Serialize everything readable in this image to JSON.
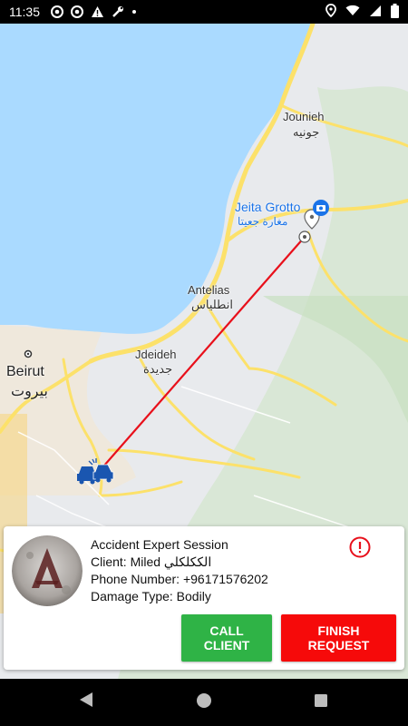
{
  "status_bar": {
    "time": "11:35",
    "left_icons": [
      "chrome-icon",
      "chrome-icon",
      "warning-icon",
      "wrench-icon",
      "dot-icon"
    ],
    "right_icons": [
      "location-icon",
      "wifi-icon",
      "signal-icon",
      "battery-icon"
    ]
  },
  "map": {
    "labels": {
      "jounieh": "Jounieh",
      "jounieh_ar": "جونيه",
      "jeita": "Jeita Grotto",
      "jeita_ar": "مغارة جعيتا",
      "antelias": "Antelias",
      "antelias_ar": "انطلياس",
      "jdeideh": "Jdeideh",
      "jdeideh_ar": "جديدة",
      "beirut": "Beirut",
      "beirut_ar": "بيروت"
    },
    "colors": {
      "water": "#aadaff",
      "land": "#e8eaed",
      "route": "#e8101b",
      "road": "#fce16a"
    }
  },
  "session": {
    "title": "Accident Expert Session",
    "client": "Client: Miled الككلكلي",
    "phone": "Phone Number: +96171576202",
    "damage": "Damage Type: Bodily"
  },
  "buttons": {
    "call": "CALL CLIENT",
    "finish": "FINISH REQUEST"
  },
  "colors": {
    "call_button": "#2fb346",
    "finish_button": "#f60a0a",
    "alert": "#e8101b"
  }
}
